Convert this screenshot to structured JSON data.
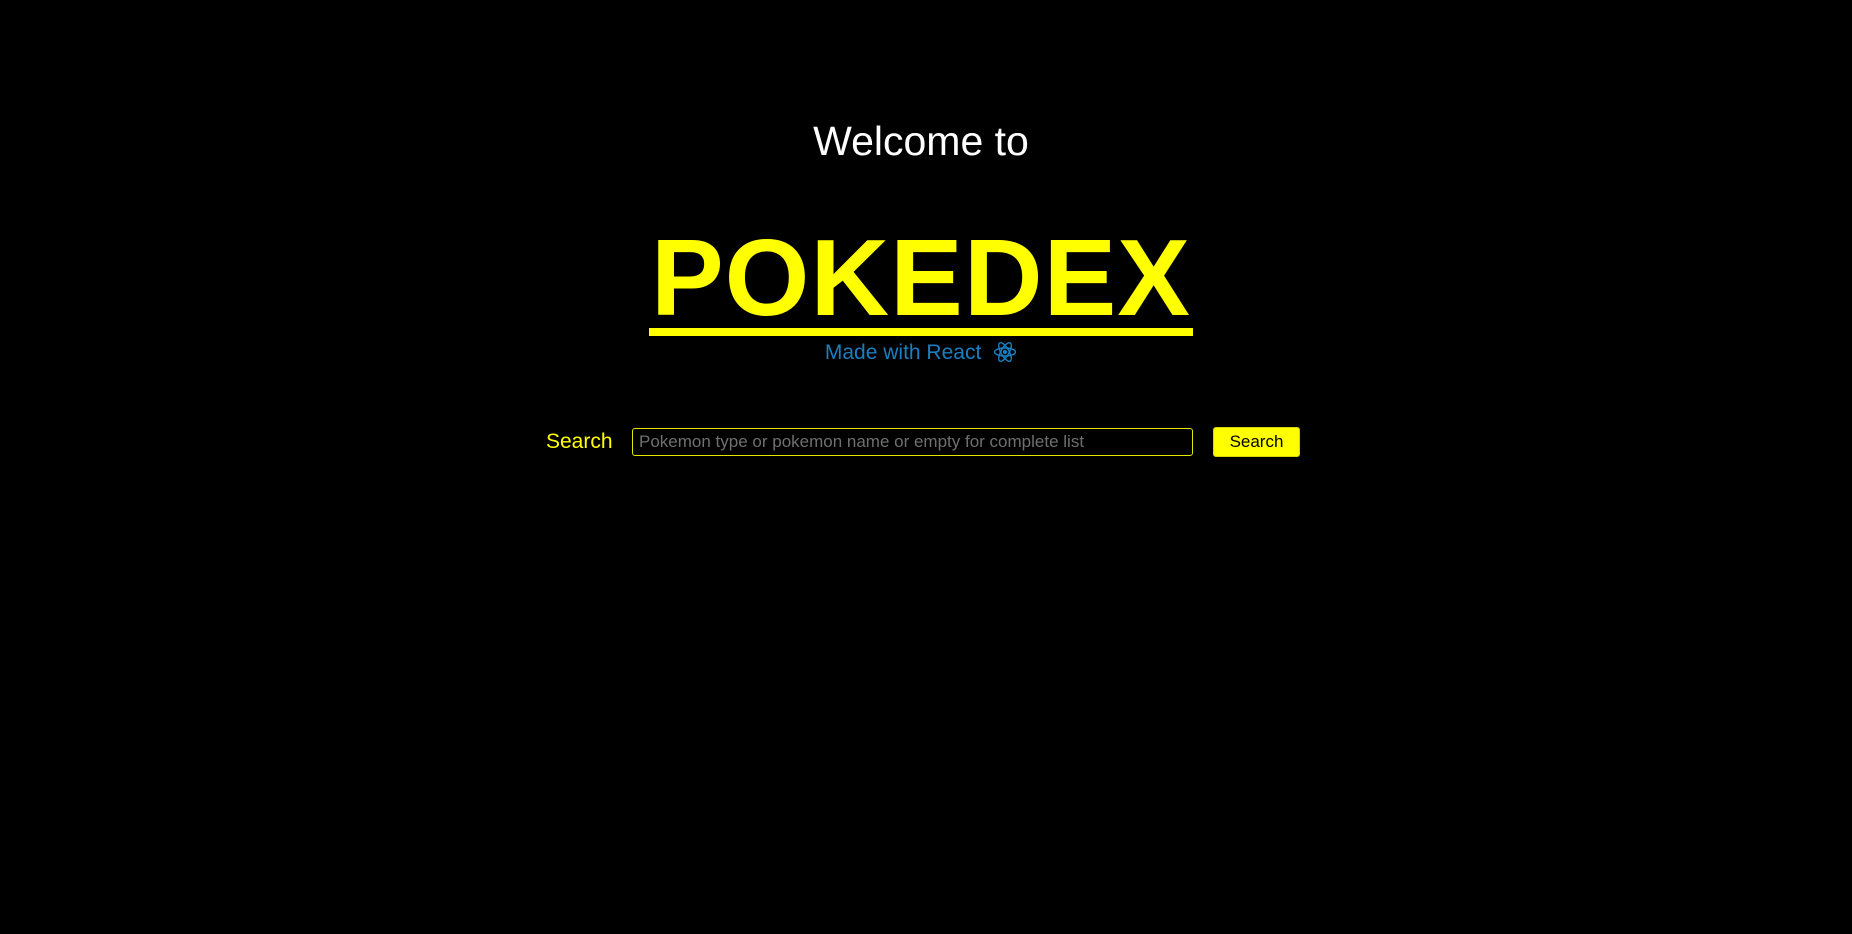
{
  "header": {
    "welcome_text": "Welcome to",
    "title": "POKEDEX",
    "subtitle": "Made with React",
    "subtitle_icon": "react-logo-icon"
  },
  "search": {
    "label": "Search",
    "placeholder": "Pokemon type or pokemon name or empty for complete list",
    "value": "",
    "button_label": "Search"
  },
  "colors": {
    "background": "#000000",
    "accent": "#ffff00",
    "welcome_text": "#ffffff",
    "subtitle_text": "#1a7fc0"
  }
}
